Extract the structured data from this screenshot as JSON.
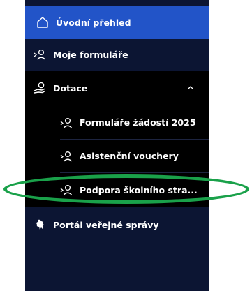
{
  "nav": {
    "overview_label": "Úvodní přehled",
    "my_forms_label": "Moje formuláře",
    "subsidies_label": "Dotace",
    "subsidies_items": [
      {
        "label": "Formuláře žádostí 2025"
      },
      {
        "label": "Asistenční vouchery"
      },
      {
        "label": "Podpora školního stra..."
      }
    ],
    "portal_label": "Portál veřejné správy"
  },
  "colors": {
    "sidebar_bg": "#0c1533",
    "active_bg": "#2254c8",
    "group_bg": "#000000",
    "highlight": "#1aa14a"
  },
  "icons": {
    "overview": "home-icon",
    "my_forms": "user-forms-icon",
    "subsidies": "money-hand-icon",
    "portal": "lion-emblem-icon"
  }
}
